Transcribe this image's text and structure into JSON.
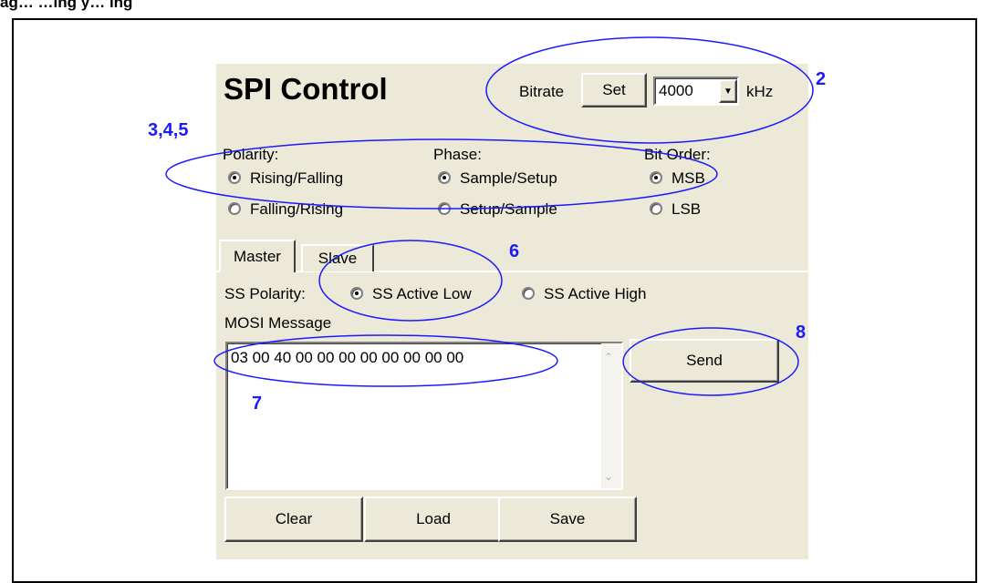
{
  "caption": "ag… …ing  y…   ing",
  "app": {
    "title": "SPI Control"
  },
  "bitrate": {
    "label": "Bitrate",
    "set_label": "Set",
    "value": "4000",
    "unit": "kHz"
  },
  "polarity": {
    "header": "Polarity:",
    "options": [
      "Rising/Falling",
      "Falling/Rising"
    ],
    "selected": 0
  },
  "phase": {
    "header": "Phase:",
    "options": [
      "Sample/Setup",
      "Setup/Sample"
    ],
    "selected": 0
  },
  "bit_order": {
    "header": "Bit Order:",
    "options": [
      "MSB",
      "LSB"
    ],
    "selected": 0
  },
  "tabs": [
    {
      "label": "Master",
      "active": true
    },
    {
      "label": "Slave",
      "active": false
    }
  ],
  "ss_polarity": {
    "label": "SS Polarity:",
    "options": [
      "SS Active Low",
      "SS Active High"
    ],
    "selected": 0
  },
  "mosi": {
    "label": "MOSI Message",
    "text": "03 00 40 00 00 00 00 00 00 00 00",
    "send_label": "Send"
  },
  "footer_buttons": {
    "clear": "Clear",
    "load": "Load",
    "save": "Save"
  },
  "annotations": [
    "2",
    "3,4,5",
    "6",
    "7",
    "8"
  ],
  "colors": {
    "panel": "#ece9d8",
    "annotation": "#1a1aff"
  }
}
